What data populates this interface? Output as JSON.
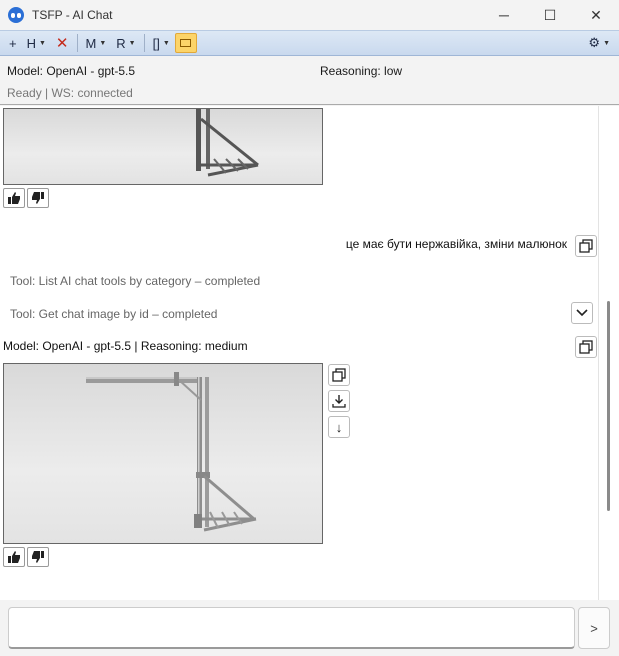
{
  "window": {
    "title": "TSFP - AI Chat",
    "controls": {
      "minimize": "─",
      "maximize": "☐",
      "close": "✕"
    }
  },
  "toolbar": {
    "add_label": "+",
    "h_label": "H",
    "close_label": "✕",
    "m_label": "M",
    "r_label": "R",
    "brackets_label": "[]",
    "dropdown_caret": "▼",
    "gear_label": "⚙"
  },
  "info": {
    "model": "Model: OpenAI - gpt-5.5",
    "reasoning": "Reasoning: low",
    "status": "Ready | WS: connected"
  },
  "chat": {
    "user_message": "це має бути нержавійка, зміни малюнок",
    "tool_1": "Tool: List AI chat tools by category – completed",
    "tool_2": "Tool: Get chat image by id – completed",
    "model_caption": "Model: OpenAI - gpt-5.5 | Reasoning: medium",
    "down_arrow": "↓"
  },
  "input": {
    "send_label": ">"
  },
  "colors": {
    "toolbar_active": "#fcd469",
    "close_red": "#c42b1c",
    "toolbar_bg": "#c9d9ee"
  }
}
